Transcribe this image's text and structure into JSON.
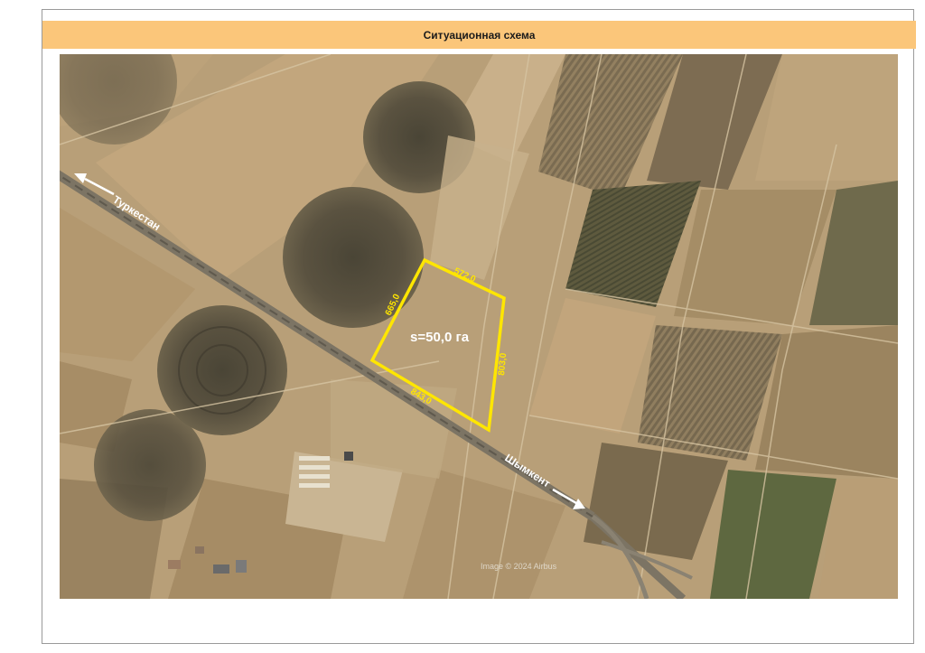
{
  "header": {
    "title": "Ситуационная схема"
  },
  "map": {
    "plot": {
      "area_label": "s=50,0 га",
      "side_top": "572,0",
      "side_left": "665,0",
      "side_right": "803,0",
      "side_bottom": "843,0",
      "outline_color": "#ffe600"
    },
    "road": {
      "west_label": "Туркестан",
      "east_label": "Шымкент",
      "west_direction_icon": "arrow-left-icon",
      "east_direction_icon": "arrow-right-icon"
    },
    "attribution": "Image © 2024 Airbus"
  }
}
